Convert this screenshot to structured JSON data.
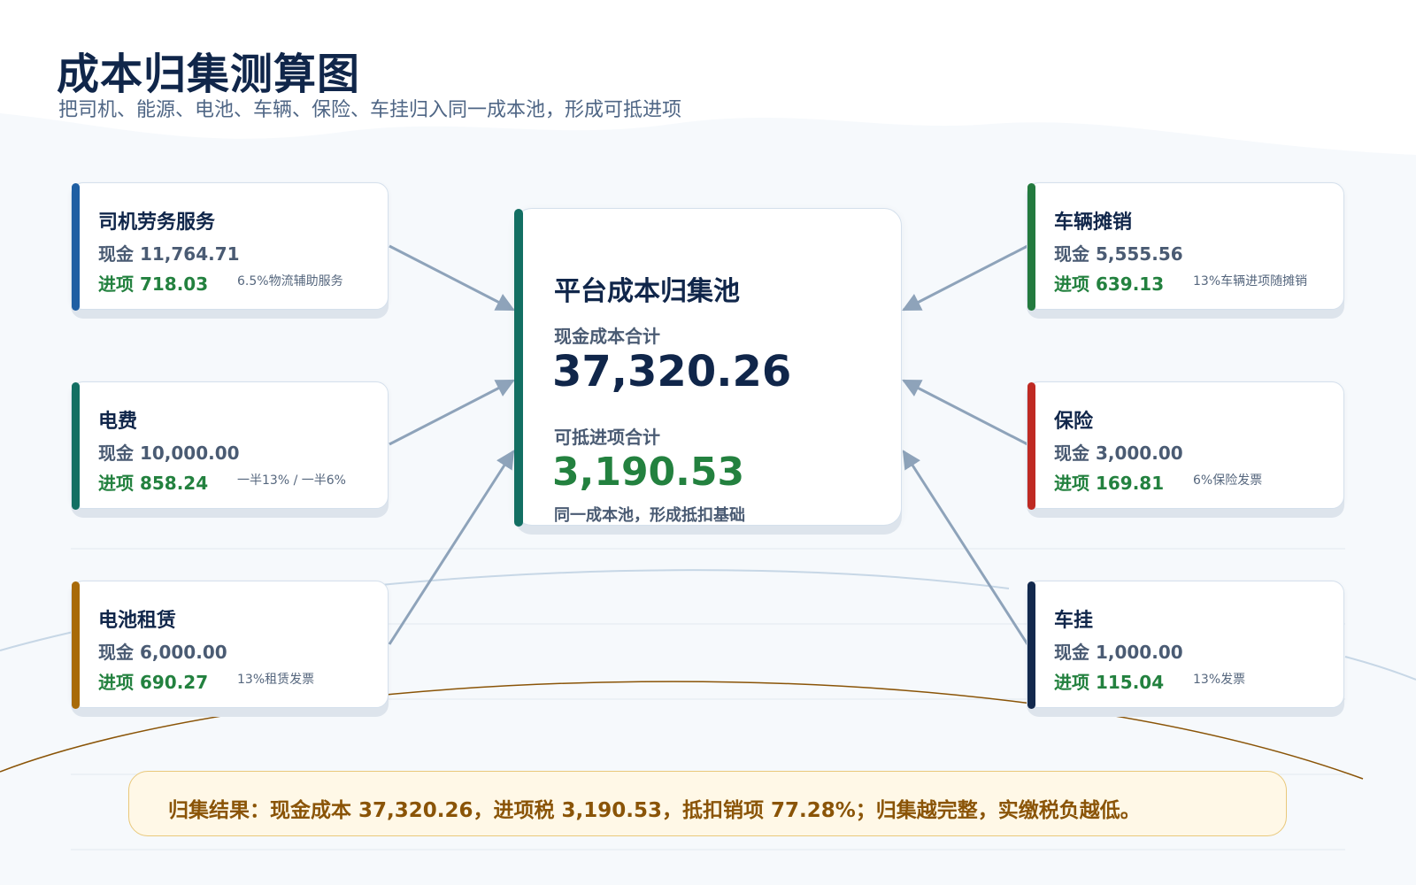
{
  "header": {
    "title": "成本归集测算图",
    "subtitle": "把司机、能源、电池、车辆、保险、车挂归入同一成本池，形成可抵进项"
  },
  "pool": {
    "title": "平台成本归集池",
    "cash_label": "现金成本合计",
    "cash_value": "37,320.26",
    "input_label": "可抵进项合计",
    "input_value": "3,190.53",
    "note": "同一成本池，形成抵扣基础"
  },
  "sources": [
    {
      "title": "司机劳务服务",
      "cash": "现金 11,764.71",
      "input": "进项 718.03",
      "note": "6.5%物流辅助服务",
      "color": "#1f5fa3"
    },
    {
      "title": "电费",
      "cash": "现金 10,000.00",
      "input": "进项 858.24",
      "note": "一半13% / 一半6%",
      "color": "#136f63"
    },
    {
      "title": "电池租赁",
      "cash": "现金 6,000.00",
      "input": "进项 690.27",
      "note": "13%租赁发票",
      "color": "#a86a08"
    },
    {
      "title": "车辆摊销",
      "cash": "现金 5,555.56",
      "input": "进项 639.13",
      "note": "13%车辆进项随摊销",
      "color": "#237a3e"
    },
    {
      "title": "保险",
      "cash": "现金 3,000.00",
      "input": "进项 169.81",
      "note": "6%保险发票",
      "color": "#bf2a23"
    },
    {
      "title": "车挂",
      "cash": "现金 1,000.00",
      "input": "进项 115.04",
      "note": "13%发票",
      "color": "#13294d"
    }
  ],
  "result": {
    "text": "归集结果：现金成本 37,320.26，进项税 3,190.53，抵扣销项 77.28%；归集越完整，实缴税负越低。"
  },
  "colors": {
    "arrow": "#8ea3ba",
    "input_green": "#23813f",
    "result_text": "#8a5407",
    "result_border": "#e9c87b"
  }
}
